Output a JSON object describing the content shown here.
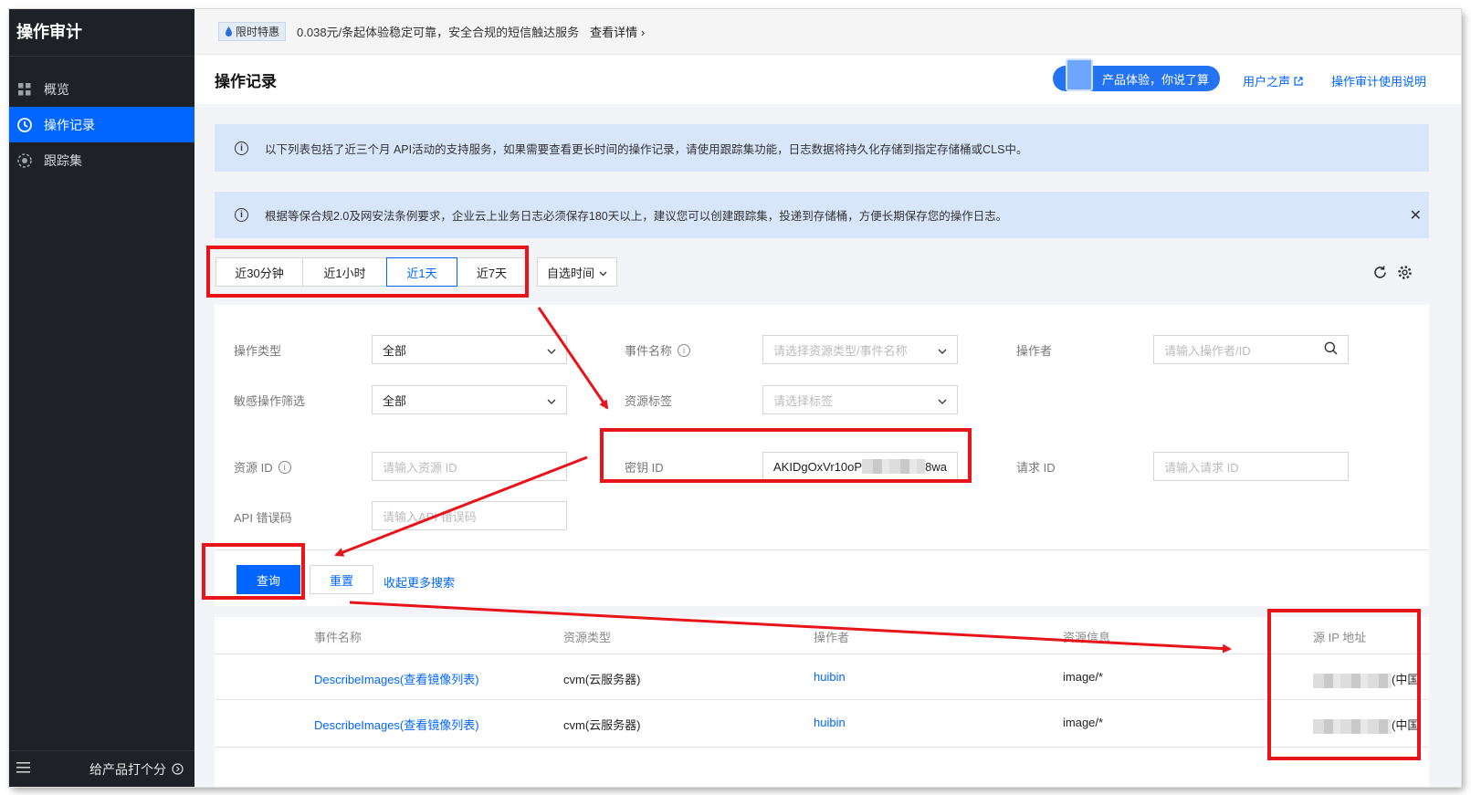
{
  "sidebar": {
    "title": "操作审计",
    "items": [
      {
        "label": "概览",
        "icon": "grid-icon"
      },
      {
        "label": "操作记录",
        "icon": "history-icon"
      },
      {
        "label": "跟踪集",
        "icon": "target-icon"
      }
    ],
    "rate_label": "给产品打个分"
  },
  "banner": {
    "badge": "限时特惠",
    "text": "0.038元/条起体验稳定可靠，安全合规的短信触达服务",
    "detail": "查看详情"
  },
  "header": {
    "title": "操作记录",
    "feedback": "产品体验，你说了算",
    "user_voice": "用户之声",
    "manual": "操作审计使用说明"
  },
  "alerts": [
    "以下列表包括了近三个月 API活动的支持服务，如果需要查看更长时间的操作记录，请使用跟踪集功能，日志数据将持久化存储到指定存储桶或CLS中。",
    "根据等保合规2.0及网安法条例要求，企业云上业务日志必须保存180天以上，建议您可以创建跟踪集，投递到存储桶，方便长期保存您的操作日志。"
  ],
  "time_tabs": [
    "近30分钟",
    "近1小时",
    "近1天",
    "近7天"
  ],
  "selected_tab": "近1天",
  "custom_time": "自选时间",
  "filters": {
    "op_type": {
      "label": "操作类型",
      "value": "全部"
    },
    "event_name": {
      "label": "事件名称",
      "placeholder": "请选择资源类型/事件名称"
    },
    "operator": {
      "label": "操作者",
      "placeholder": "请输入操作者/ID"
    },
    "sensitive": {
      "label": "敏感操作筛选",
      "value": "全部"
    },
    "resource_tag": {
      "label": "资源标签",
      "placeholder": "请选择标签"
    },
    "resource_id": {
      "label": "资源 ID",
      "placeholder": "请输入资源 ID"
    },
    "secret_id": {
      "label": "密钥 ID",
      "value_prefix": "AKIDgOxVr10oP",
      "value_suffix": "8wa"
    },
    "request_id": {
      "label": "请求 ID",
      "placeholder": "请输入请求 ID"
    },
    "api_error": {
      "label": "API 错误码",
      "placeholder": "请输入API 错误码"
    }
  },
  "buttons": {
    "query": "查询",
    "reset": "重置",
    "collapse": "收起更多搜索"
  },
  "table": {
    "columns": [
      "事件名称",
      "资源类型",
      "操作者",
      "资源信息",
      "源 IP 地址"
    ],
    "rows": [
      {
        "event": "DescribeImages(查看镜像列表)",
        "resource_type": "cvm(云服务器)",
        "operator": "huibin",
        "resource_info": "image/*",
        "ip_suffix": "(中国"
      },
      {
        "event": "DescribeImages(查看镜像列表)",
        "resource_type": "cvm(云服务器)",
        "operator": "huibin",
        "resource_info": "image/*",
        "ip_suffix": "(中国"
      }
    ]
  },
  "colors": {
    "accent": "#0066ff",
    "sidebar_bg": "#1e2227",
    "annotation_red": "#e8141a",
    "alert_bg": "#d7e6fb"
  }
}
